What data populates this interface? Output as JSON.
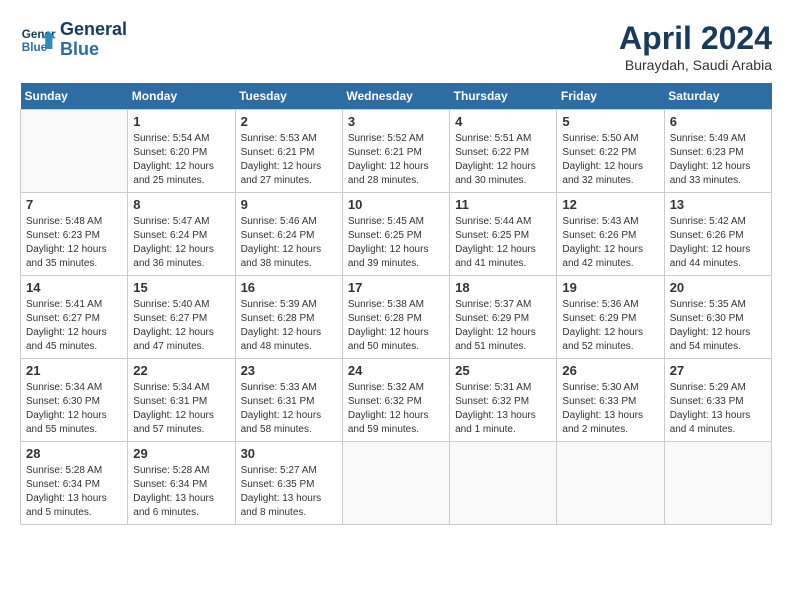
{
  "header": {
    "logo_line1": "General",
    "logo_line2": "Blue",
    "month": "April 2024",
    "location": "Buraydah, Saudi Arabia"
  },
  "days_of_week": [
    "Sunday",
    "Monday",
    "Tuesday",
    "Wednesday",
    "Thursday",
    "Friday",
    "Saturday"
  ],
  "weeks": [
    [
      {
        "num": "",
        "info": ""
      },
      {
        "num": "1",
        "info": "Sunrise: 5:54 AM\nSunset: 6:20 PM\nDaylight: 12 hours\nand 25 minutes."
      },
      {
        "num": "2",
        "info": "Sunrise: 5:53 AM\nSunset: 6:21 PM\nDaylight: 12 hours\nand 27 minutes."
      },
      {
        "num": "3",
        "info": "Sunrise: 5:52 AM\nSunset: 6:21 PM\nDaylight: 12 hours\nand 28 minutes."
      },
      {
        "num": "4",
        "info": "Sunrise: 5:51 AM\nSunset: 6:22 PM\nDaylight: 12 hours\nand 30 minutes."
      },
      {
        "num": "5",
        "info": "Sunrise: 5:50 AM\nSunset: 6:22 PM\nDaylight: 12 hours\nand 32 minutes."
      },
      {
        "num": "6",
        "info": "Sunrise: 5:49 AM\nSunset: 6:23 PM\nDaylight: 12 hours\nand 33 minutes."
      }
    ],
    [
      {
        "num": "7",
        "info": "Sunrise: 5:48 AM\nSunset: 6:23 PM\nDaylight: 12 hours\nand 35 minutes."
      },
      {
        "num": "8",
        "info": "Sunrise: 5:47 AM\nSunset: 6:24 PM\nDaylight: 12 hours\nand 36 minutes."
      },
      {
        "num": "9",
        "info": "Sunrise: 5:46 AM\nSunset: 6:24 PM\nDaylight: 12 hours\nand 38 minutes."
      },
      {
        "num": "10",
        "info": "Sunrise: 5:45 AM\nSunset: 6:25 PM\nDaylight: 12 hours\nand 39 minutes."
      },
      {
        "num": "11",
        "info": "Sunrise: 5:44 AM\nSunset: 6:25 PM\nDaylight: 12 hours\nand 41 minutes."
      },
      {
        "num": "12",
        "info": "Sunrise: 5:43 AM\nSunset: 6:26 PM\nDaylight: 12 hours\nand 42 minutes."
      },
      {
        "num": "13",
        "info": "Sunrise: 5:42 AM\nSunset: 6:26 PM\nDaylight: 12 hours\nand 44 minutes."
      }
    ],
    [
      {
        "num": "14",
        "info": "Sunrise: 5:41 AM\nSunset: 6:27 PM\nDaylight: 12 hours\nand 45 minutes."
      },
      {
        "num": "15",
        "info": "Sunrise: 5:40 AM\nSunset: 6:27 PM\nDaylight: 12 hours\nand 47 minutes."
      },
      {
        "num": "16",
        "info": "Sunrise: 5:39 AM\nSunset: 6:28 PM\nDaylight: 12 hours\nand 48 minutes."
      },
      {
        "num": "17",
        "info": "Sunrise: 5:38 AM\nSunset: 6:28 PM\nDaylight: 12 hours\nand 50 minutes."
      },
      {
        "num": "18",
        "info": "Sunrise: 5:37 AM\nSunset: 6:29 PM\nDaylight: 12 hours\nand 51 minutes."
      },
      {
        "num": "19",
        "info": "Sunrise: 5:36 AM\nSunset: 6:29 PM\nDaylight: 12 hours\nand 52 minutes."
      },
      {
        "num": "20",
        "info": "Sunrise: 5:35 AM\nSunset: 6:30 PM\nDaylight: 12 hours\nand 54 minutes."
      }
    ],
    [
      {
        "num": "21",
        "info": "Sunrise: 5:34 AM\nSunset: 6:30 PM\nDaylight: 12 hours\nand 55 minutes."
      },
      {
        "num": "22",
        "info": "Sunrise: 5:34 AM\nSunset: 6:31 PM\nDaylight: 12 hours\nand 57 minutes."
      },
      {
        "num": "23",
        "info": "Sunrise: 5:33 AM\nSunset: 6:31 PM\nDaylight: 12 hours\nand 58 minutes."
      },
      {
        "num": "24",
        "info": "Sunrise: 5:32 AM\nSunset: 6:32 PM\nDaylight: 12 hours\nand 59 minutes."
      },
      {
        "num": "25",
        "info": "Sunrise: 5:31 AM\nSunset: 6:32 PM\nDaylight: 13 hours\nand 1 minute."
      },
      {
        "num": "26",
        "info": "Sunrise: 5:30 AM\nSunset: 6:33 PM\nDaylight: 13 hours\nand 2 minutes."
      },
      {
        "num": "27",
        "info": "Sunrise: 5:29 AM\nSunset: 6:33 PM\nDaylight: 13 hours\nand 4 minutes."
      }
    ],
    [
      {
        "num": "28",
        "info": "Sunrise: 5:28 AM\nSunset: 6:34 PM\nDaylight: 13 hours\nand 5 minutes."
      },
      {
        "num": "29",
        "info": "Sunrise: 5:28 AM\nSunset: 6:34 PM\nDaylight: 13 hours\nand 6 minutes."
      },
      {
        "num": "30",
        "info": "Sunrise: 5:27 AM\nSunset: 6:35 PM\nDaylight: 13 hours\nand 8 minutes."
      },
      {
        "num": "",
        "info": ""
      },
      {
        "num": "",
        "info": ""
      },
      {
        "num": "",
        "info": ""
      },
      {
        "num": "",
        "info": ""
      }
    ]
  ]
}
